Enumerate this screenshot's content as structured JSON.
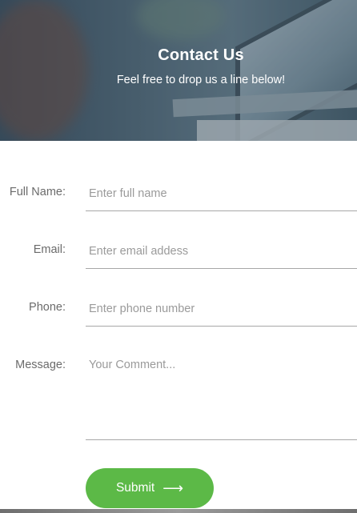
{
  "hero": {
    "title": "Contact Us",
    "subtitle": "Feel free to drop us a line below!"
  },
  "form": {
    "fields": [
      {
        "label": "Full Name:",
        "placeholder": "Enter full name"
      },
      {
        "label": "Email:",
        "placeholder": "Enter email addess"
      },
      {
        "label": "Phone:",
        "placeholder": "Enter phone number"
      },
      {
        "label": "Message:",
        "placeholder": "Your Comment..."
      }
    ],
    "submit_label": "Submit",
    "submit_icon": "arrow-right-icon"
  },
  "colors": {
    "accent": "#5cb947",
    "label": "#6b6b6b",
    "placeholder": "#9a9a9a"
  }
}
